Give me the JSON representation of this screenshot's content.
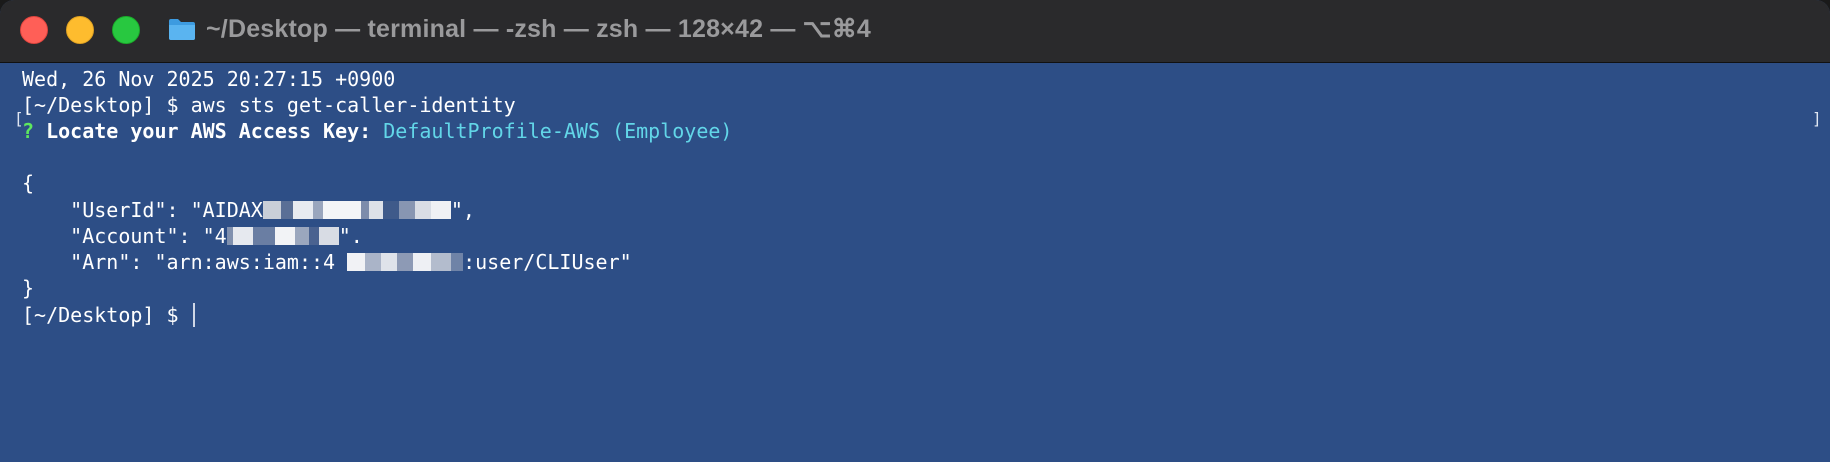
{
  "window": {
    "title": "~/Desktop — terminal — -zsh — zsh — 128×42 — ⌥⌘4",
    "folder_icon": "folder-icon",
    "traffic_lights": {
      "close_color": "#ff5f57",
      "minimize_color": "#febc2e",
      "maximize_color": "#28c840"
    }
  },
  "terminal": {
    "background_color": "#2d4e86",
    "date_line": "Wed, 26 Nov 2025 20:27:15 +0900",
    "command_line": {
      "prompt": "[~/Desktop] $ ",
      "command": "aws sts get-caller-identity"
    },
    "question": {
      "mark": "?",
      "text": " Locate your AWS Access Key: ",
      "answer": "DefaultProfile-AWS (Employee)"
    },
    "json_open": "{",
    "user_id": {
      "key_part": "    \"UserId\": \"AIDAX",
      "tail": "\","
    },
    "account": {
      "key_part": "    \"Account\": \"4",
      "tail": "\"."
    },
    "arn": {
      "key_part": "    \"Arn\": \"arn:aws:iam::4",
      "tail": ":user/CLIUser\""
    },
    "json_close": "}",
    "final_prompt": "[~/Desktop] $ "
  }
}
